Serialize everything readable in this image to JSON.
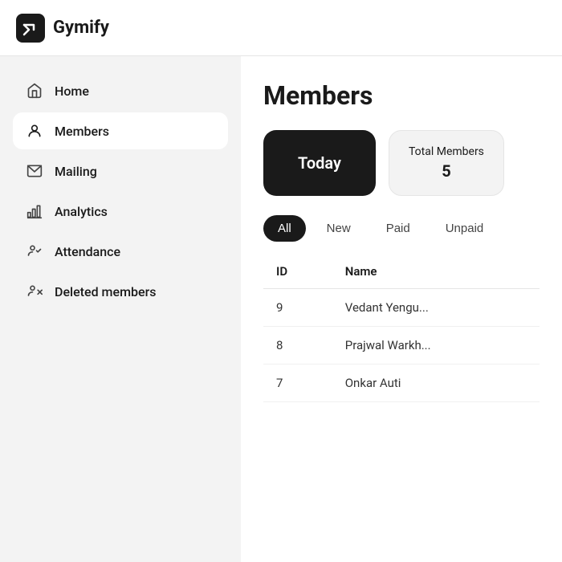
{
  "header": {
    "app_name": "Gymify",
    "logo_alt": "gymify-logo"
  },
  "sidebar": {
    "items": [
      {
        "id": "home",
        "label": "Home",
        "icon": "home-icon"
      },
      {
        "id": "members",
        "label": "Members",
        "icon": "members-icon",
        "active": true
      },
      {
        "id": "mailing",
        "label": "Mailing",
        "icon": "mailing-icon"
      },
      {
        "id": "analytics",
        "label": "Analytics",
        "icon": "analytics-icon"
      },
      {
        "id": "attendance",
        "label": "Attendance",
        "icon": "attendance-icon"
      },
      {
        "id": "deleted",
        "label": "Deleted members",
        "icon": "deleted-icon"
      }
    ]
  },
  "main": {
    "page_title": "Members",
    "stats": [
      {
        "id": "today",
        "label": "Today",
        "type": "dark"
      },
      {
        "id": "total",
        "label": "Total Members",
        "value": "5",
        "type": "light"
      }
    ],
    "filter_tabs": [
      {
        "id": "all",
        "label": "All",
        "active": true
      },
      {
        "id": "new",
        "label": "New",
        "active": false
      },
      {
        "id": "paid",
        "label": "Paid",
        "active": false
      },
      {
        "id": "unpaid",
        "label": "Unpaid",
        "active": false
      }
    ],
    "table": {
      "columns": [
        {
          "id": "id",
          "label": "ID"
        },
        {
          "id": "name",
          "label": "Name"
        }
      ],
      "rows": [
        {
          "id": "9",
          "name": "Vedant Yengu..."
        },
        {
          "id": "8",
          "name": "Prajwal Warkh..."
        },
        {
          "id": "7",
          "name": "Onkar Auti"
        }
      ]
    }
  }
}
